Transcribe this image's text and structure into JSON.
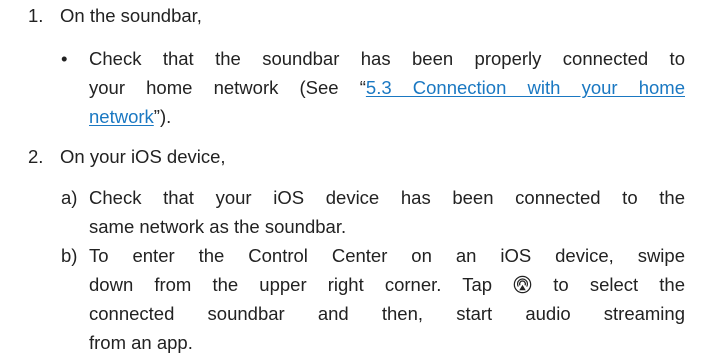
{
  "steps": [
    {
      "number": "1.",
      "text": "On the soundbar,",
      "bullets": [
        {
          "marker": "•",
          "line1": "Check that the soundbar has been properly connected to",
          "line2_prefix": "your home network (See “",
          "link_part1": "5.3 Connection with your home",
          "link_part2": "network",
          "line3_suffix": "”)."
        }
      ]
    },
    {
      "number": "2.",
      "text": "On your iOS device,",
      "subitems": [
        {
          "marker": "a)",
          "lines": [
            "Check that your iOS device has been connected to the",
            "same network as the soundbar."
          ]
        },
        {
          "marker": "b)",
          "lines": [
            "To enter the Control Center on an iOS device, swipe",
            "Tap",
            "to select the",
            "connected soundbar and then, start audio streaming",
            "from an app."
          ],
          "line2_prefix": "down from the upper right corner.",
          "icon": "airplay-audio-icon"
        }
      ]
    }
  ],
  "colors": {
    "text": "#222222",
    "link": "#1a78c2"
  }
}
